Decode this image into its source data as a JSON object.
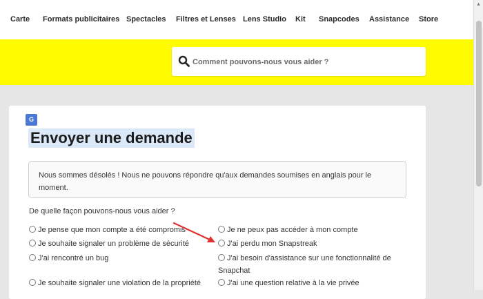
{
  "nav": {
    "items": [
      {
        "label": "Carte"
      },
      {
        "label": "Formats publicitaires"
      },
      {
        "label": "Spectacles"
      },
      {
        "label": "Filtres et Lenses"
      },
      {
        "label": "Lens Studio"
      },
      {
        "label": "Kit"
      },
      {
        "label": "Snapcodes"
      },
      {
        "label": "Assistance"
      },
      {
        "label": "Store"
      }
    ]
  },
  "search": {
    "placeholder": "Comment pouvons-nous vous aider ?",
    "icon": "search-icon"
  },
  "page": {
    "title": "Envoyer une demande",
    "translate_icon": "translate-icon",
    "notice": "Nous sommes désolés ! Nous ne pouvons répondre qu'aux demandes soumises en anglais pour le moment.",
    "question": "De quelle façon pouvons-nous vous aider ?"
  },
  "options": {
    "left": [
      "Je pense que mon compte a été compromis",
      "Je souhaite signaler un problème de sécurité",
      "J'ai rencontré un bug",
      "Je souhaite signaler une violation de la propriété"
    ],
    "right": [
      "Je ne peux pas accéder à mon compte",
      "J'ai perdu mon Snapstreak",
      "J'ai besoin d'assistance sur une fonctionnalité de Snapchat",
      "J'ai une question relative à la vie privée"
    ]
  },
  "colors": {
    "brand_yellow": "#fffc00",
    "annotation_arrow": "#e03131"
  }
}
